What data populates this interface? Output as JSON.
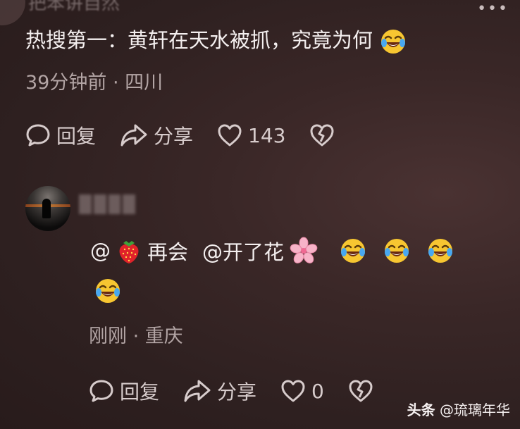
{
  "top_comment": {
    "username_partial": "把苯讲自然",
    "text": "热搜第一：黄轩在天水被抓，究竟为何",
    "time": "39分钟前",
    "location": "四川",
    "reply_label": "回复",
    "share_label": "分享",
    "like_count": "143"
  },
  "reply_comment": {
    "text_at": "@",
    "text_name1": "再会",
    "text_at2": "@开了花",
    "time": "刚刚",
    "location": "重庆",
    "reply_label": "回复",
    "share_label": "分享",
    "like_count": "0"
  },
  "separator": "·",
  "more_menu": "•••",
  "watermark": {
    "brand": "头条",
    "handle": "@琉璃年华"
  },
  "colors": {
    "text_primary": "#f4efef",
    "text_secondary": "#b3a5a5",
    "icon": "#d7cccc"
  },
  "icons": [
    "speech-bubble-icon",
    "share-arrow-icon",
    "heart-icon",
    "broken-heart-icon",
    "laughing-crying-emoji",
    "strawberry-emoji",
    "cherry-blossom-emoji"
  ]
}
